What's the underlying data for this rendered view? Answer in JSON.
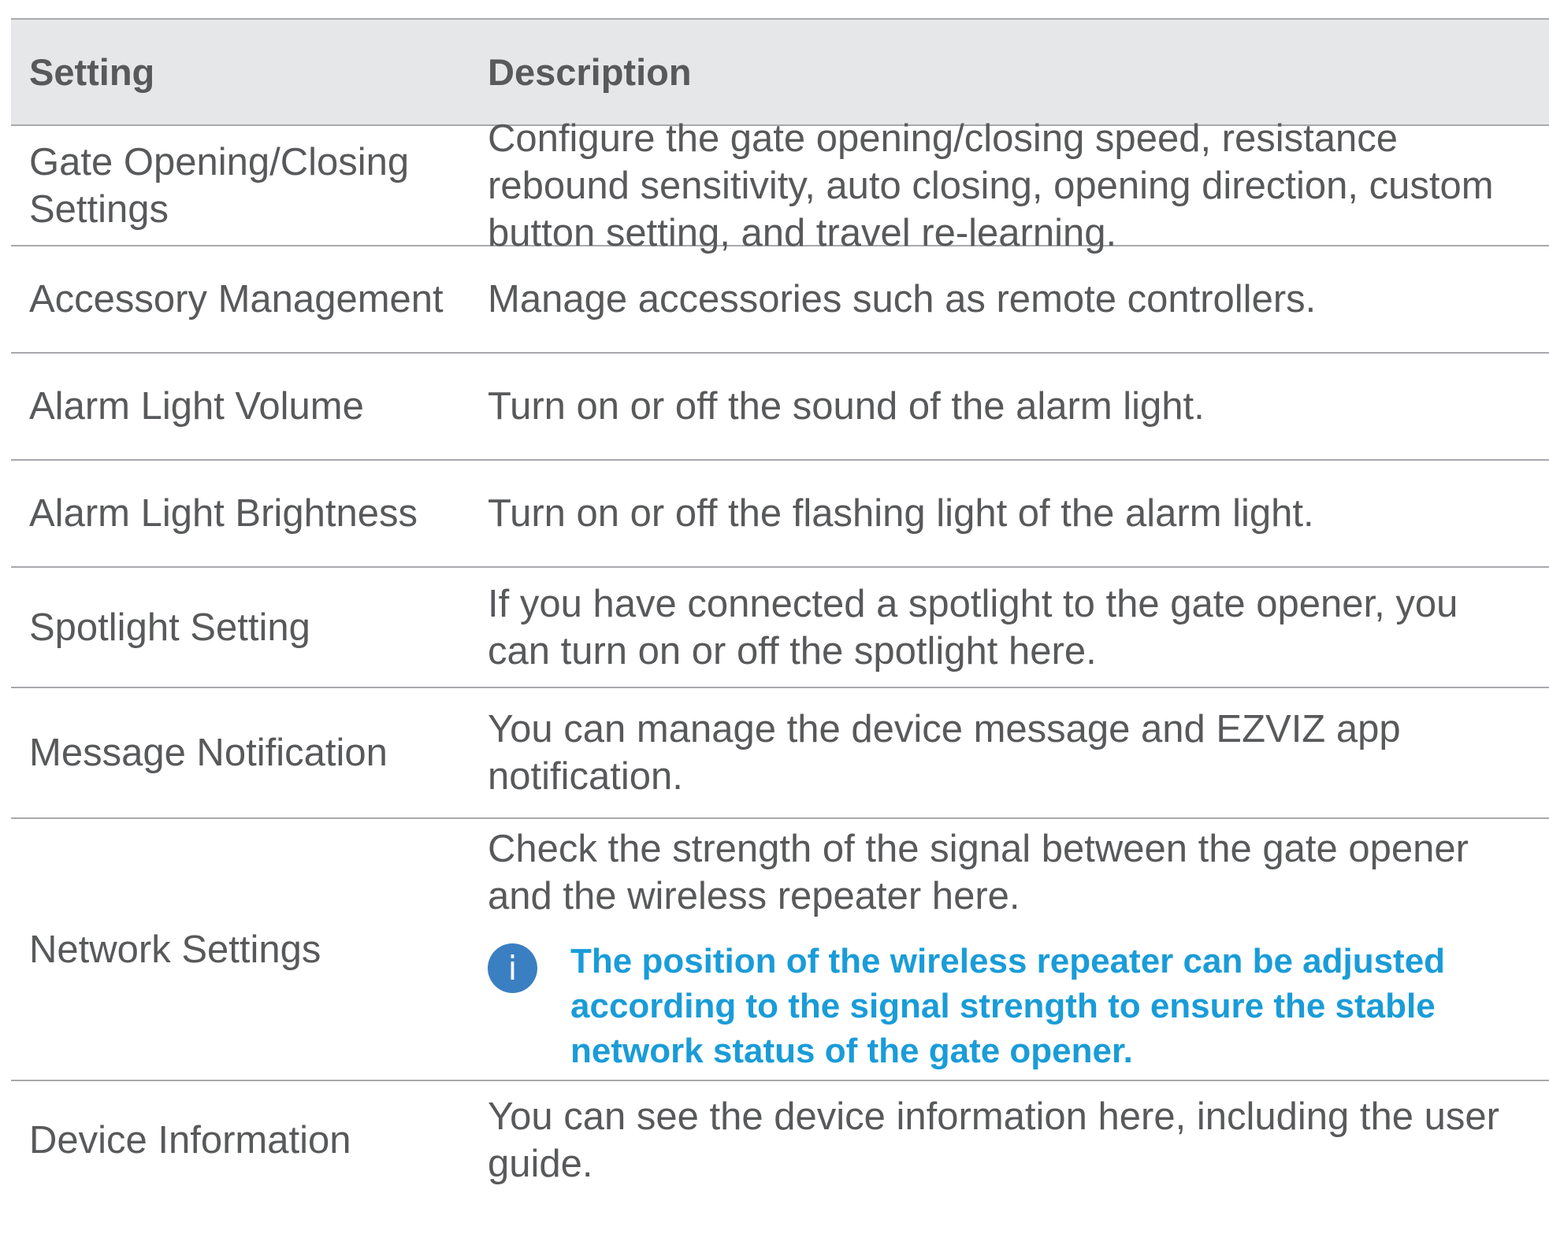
{
  "table": {
    "header": {
      "setting": "Setting",
      "description": "Description"
    },
    "rows": [
      {
        "setting": "Gate Opening/Closing\nSettings",
        "description": "Configure the gate opening/closing speed, resistance\nrebound sensitivity, auto closing, opening direction, custom\nbutton setting, and travel re-learning."
      },
      {
        "setting": "Accessory Management",
        "description": "Manage accessories such as remote controllers."
      },
      {
        "setting": "Alarm Light Volume",
        "description": "Turn on or off the sound of the alarm light."
      },
      {
        "setting": "Alarm Light Brightness",
        "description": "Turn on or off the flashing light of the alarm light."
      },
      {
        "setting": "Spotlight Setting",
        "description": "If you have connected a spotlight to the gate opener, you\ncan turn on or off the spotlight here."
      },
      {
        "setting": "Message Notification",
        "description": "You can manage the device message and EZVIZ app\nnotification."
      },
      {
        "setting": "Network Settings",
        "description": "Check the strength of the signal between the gate opener\nand the wireless repeater here.",
        "note": {
          "icon": "info-icon",
          "icon_glyph": "i",
          "text": "The position of the wireless repeater can be adjusted\naccording to the signal strength to ensure the stable\nnetwork status of the gate opener."
        }
      },
      {
        "setting": "Device Information",
        "description": "You can see the device information here, including the user\nguide."
      }
    ]
  },
  "colors": {
    "header_background": "#e6e7e8",
    "text": "#58595b",
    "divider": "#a7a9ac",
    "note_text": "#1a9cd8",
    "info_icon": "#3a7fc2"
  }
}
